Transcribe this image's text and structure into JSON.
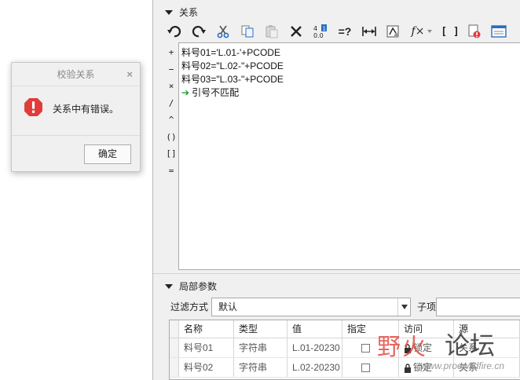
{
  "dialog": {
    "title": "校验关系",
    "close": "×",
    "message": "关系中有错误。",
    "ok_label": "确定"
  },
  "relations": {
    "header": "关系",
    "toolbar_icons": [
      "undo-icon",
      "redo-icon",
      "cut-icon",
      "copy-icon",
      "paste-icon",
      "delete-icon",
      "sort-icon",
      "evaluate-icon",
      "measure-icon",
      "display-icon",
      "function-icon",
      "brackets-icon",
      "verify-icon",
      "window-icon"
    ],
    "equals_label": "=?",
    "function_label": "f×",
    "brackets_label": "[ ]",
    "operators": [
      "+",
      "−",
      "×",
      "/",
      "^",
      "()",
      "[]",
      "="
    ],
    "lines": [
      "料号01='L.01-'+PCODE",
      "料号02=\"L.02-\"+PCODE",
      "料号03=\"L.03-\"+PCODE"
    ],
    "error_arrow": "➔",
    "error_text": "引号不匹配"
  },
  "local_params": {
    "header": "局部参数",
    "filter_label": "过滤方式",
    "filter_value": "默认",
    "sub_label": "子项",
    "columns": [
      "名称",
      "类型",
      "值",
      "指定",
      "访问",
      "源"
    ],
    "rows": [
      {
        "name": "料号01",
        "type": "字符串",
        "value": "L.01-20230",
        "access": "锁定",
        "source": "关系"
      },
      {
        "name": "料号02",
        "type": "字符串",
        "value": "L.02-20230",
        "access": "锁定",
        "source": "关系"
      }
    ]
  },
  "watermark": {
    "main1": "野火",
    "main2": "论坛",
    "url": "www.proewildfire.cn"
  }
}
